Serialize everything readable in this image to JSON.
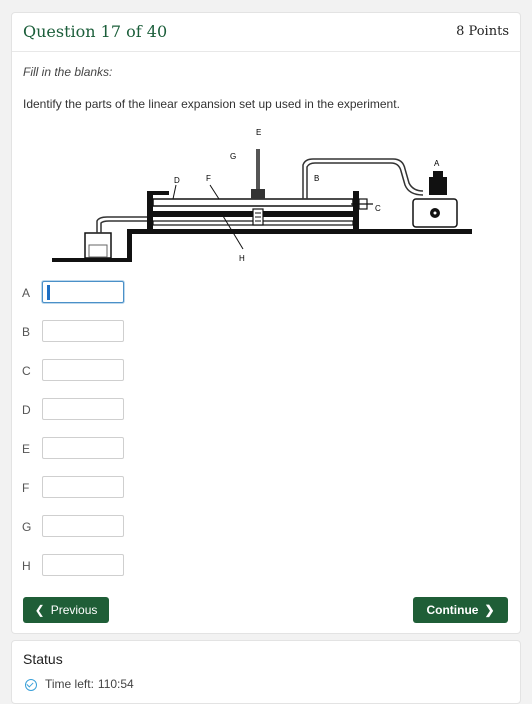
{
  "question": {
    "title": "Question 17 of 40",
    "points": "8 Points",
    "instruction": "Fill in the blanks:",
    "prompt": "Identify the parts of the linear expansion set up used in the experiment."
  },
  "diagram": {
    "labels": {
      "A": "A",
      "B": "B",
      "C": "C",
      "D": "D",
      "E": "E",
      "F": "F",
      "G": "G",
      "H": "H"
    }
  },
  "blanks": [
    {
      "label": "A",
      "value": ""
    },
    {
      "label": "B",
      "value": ""
    },
    {
      "label": "C",
      "value": ""
    },
    {
      "label": "D",
      "value": ""
    },
    {
      "label": "E",
      "value": ""
    },
    {
      "label": "F",
      "value": ""
    },
    {
      "label": "G",
      "value": ""
    },
    {
      "label": "H",
      "value": ""
    }
  ],
  "nav": {
    "previous_label": "Previous",
    "continue_label": "Continue"
  },
  "status": {
    "title": "Status",
    "time_left_label": "Time left:",
    "time_left_value": "110:54"
  },
  "colors": {
    "accent": "#1f5e37",
    "title": "#1b5e3a",
    "focus": "#1e6fc4"
  }
}
